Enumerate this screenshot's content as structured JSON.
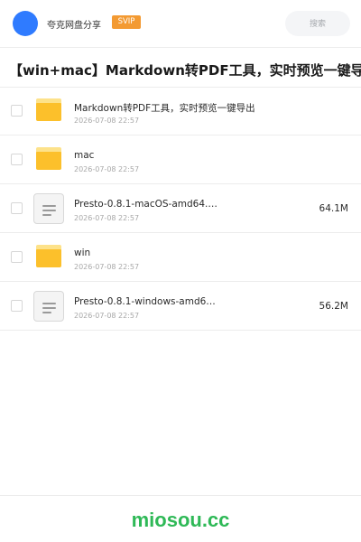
{
  "header": {
    "site_name": "夸克网盘分享",
    "badge": "SVIP",
    "search_placeholder": "搜索"
  },
  "share": {
    "title": "【win+mac】Markdown转PDF工具，实时预览一键导出"
  },
  "files": [
    {
      "type": "folder",
      "name": "Markdown转PDF工具，实时预览一键导出",
      "date": "2026-07-08 22:57",
      "size": ""
    },
    {
      "type": "folder",
      "name": "mac",
      "date": "2026-07-08 22:57",
      "size": ""
    },
    {
      "type": "file",
      "name": "Presto-0.8.1-macOS-amd64.…",
      "date": "2026-07-08 22:57",
      "size": "64.1M"
    },
    {
      "type": "folder",
      "name": "win",
      "date": "2026-07-08 22:57",
      "size": ""
    },
    {
      "type": "file",
      "name": "Presto-0.8.1-windows-amd6…",
      "date": "2026-07-08 22:57",
      "size": "56.2M"
    }
  ],
  "footer": {
    "brand": "miosou.cc",
    "brand_color": "#2fb957"
  },
  "colors": {
    "avatar": "#2f7bff",
    "badge": "#f39a32",
    "folder": "#fcc02b"
  },
  "icons": {
    "folder": "folder-icon",
    "file": "document-icon"
  }
}
